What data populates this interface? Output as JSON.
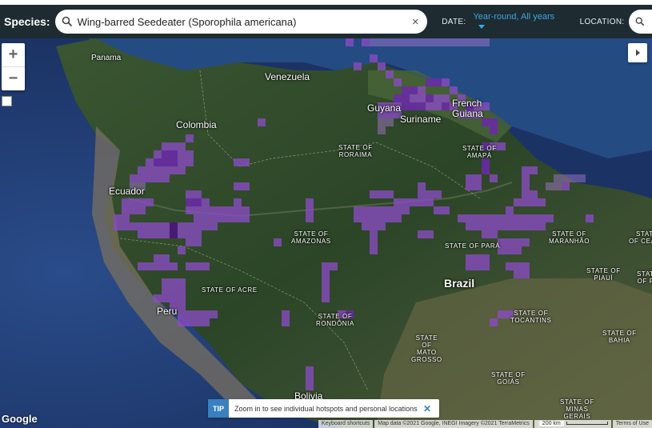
{
  "header": {
    "species_label": "Species:",
    "search_value": "Wing-barred Seedeater (Sporophila americana)",
    "clear_glyph": "×",
    "date_label": "DATE:",
    "date_value": "Year-round, All years",
    "location_label": "LOCATION:"
  },
  "map_controls": {
    "zoom_in": "+",
    "zoom_out": "−"
  },
  "labels": {
    "panama": "Panama",
    "venezuela": "Venezuela",
    "colombia": "Colombia",
    "guyana": "Guyana",
    "suriname": "Suriname",
    "french_guiana": "French\nGuiana",
    "ecuador": "Ecuador",
    "peru": "Peru",
    "brazil": "Brazil",
    "bolivia": "Bolivia",
    "roraima": "STATE OF\nRORAIMA",
    "amapa": "STATE OF\nAMAPÁ",
    "amazonas": "STATE OF\nAMAZONAS",
    "para": "STATE OF PARÁ",
    "maranhao": "STATE OF\nMARANHÃO",
    "ceara": "STATE\nOF CEARÁ",
    "piaui": "STATE OF\nPIAUÍ",
    "paraiba": "STATE\nOF PA",
    "acre": "STATE OF ACRE",
    "rondonia": "STATE OF\nRONDÔNIA",
    "tocantins": "STATE OF\nTOCANTINS",
    "bahia": "STATE OF\nBAHIA",
    "mato_grosso": "STATE\nOF\nMATO\nGROSSO",
    "goias": "STATE OF\nGOIÁS",
    "minas_gerais": "STATE OF\nMINAS\nGERAIS",
    "colombia_top": "Colombia"
  },
  "tip": {
    "badge": "TIP",
    "text": "Zoom in to see individual hotspots and personal locations",
    "close": "✕"
  },
  "attribution": {
    "logo": "Google",
    "shortcuts": "Keyboard shortcuts",
    "map_data": "Map data ©2021 Google, INEGI Imagery ©2021 TerraMetrics",
    "scale": "200 km",
    "terms": "Terms of Use"
  },
  "colors": {
    "header_bg": "#1e2b30",
    "date_accent": "#3aa7e8",
    "ocean": "#1f3b6e",
    "land": "#2f4a2c",
    "range_light": "#b07ad9",
    "range_mid": "#8a4cc4",
    "range_dark": "#4a1877",
    "tip_badge": "#3a7fc0"
  },
  "icons": {
    "search": "search-icon",
    "clear": "close-icon",
    "caret": "chevron-down-icon",
    "panel": "chevron-right-icon",
    "zoom_box": "zoom-area-icon"
  },
  "range_cells": [
    [
      432,
      0,
      2
    ],
    [
      452,
      0,
      2
    ],
    [
      462,
      0,
      1
    ],
    [
      472,
      0,
      1
    ],
    [
      482,
      0,
      1
    ],
    [
      492,
      0,
      1
    ],
    [
      502,
      0,
      1
    ],
    [
      512,
      0,
      1
    ],
    [
      522,
      0,
      1
    ],
    [
      532,
      0,
      1
    ],
    [
      542,
      0,
      1
    ],
    [
      552,
      0,
      1
    ],
    [
      562,
      0,
      1
    ],
    [
      572,
      0,
      1
    ],
    [
      582,
      0,
      1
    ],
    [
      592,
      0,
      1
    ],
    [
      602,
      0,
      1
    ],
    [
      442,
      30,
      2
    ],
    [
      462,
      20,
      2
    ],
    [
      472,
      30,
      2
    ],
    [
      482,
      40,
      2
    ],
    [
      492,
      50,
      2
    ],
    [
      502,
      60,
      3
    ],
    [
      512,
      60,
      3
    ],
    [
      522,
      60,
      2
    ],
    [
      532,
      50,
      3
    ],
    [
      542,
      50,
      3
    ],
    [
      552,
      50,
      2
    ],
    [
      562,
      60,
      2
    ],
    [
      572,
      70,
      2
    ],
    [
      582,
      80,
      3
    ],
    [
      592,
      90,
      2
    ],
    [
      602,
      100,
      3
    ],
    [
      612,
      100,
      3
    ],
    [
      612,
      110,
      3
    ],
    [
      622,
      130,
      2
    ],
    [
      612,
      130,
      2
    ],
    [
      492,
      70,
      3
    ],
    [
      502,
      70,
      3
    ],
    [
      512,
      70,
      2
    ],
    [
      522,
      70,
      2
    ],
    [
      532,
      70,
      3
    ],
    [
      542,
      70,
      2
    ],
    [
      552,
      70,
      2
    ],
    [
      562,
      80,
      2
    ],
    [
      572,
      90,
      2
    ],
    [
      582,
      90,
      2
    ],
    [
      592,
      80,
      2
    ],
    [
      602,
      80,
      2
    ],
    [
      492,
      80,
      2
    ],
    [
      502,
      80,
      3
    ],
    [
      512,
      80,
      3
    ],
    [
      522,
      80,
      3
    ],
    [
      532,
      80,
      2
    ],
    [
      542,
      80,
      2
    ],
    [
      552,
      80,
      3
    ],
    [
      472,
      80,
      2
    ],
    [
      482,
      80,
      2
    ],
    [
      472,
      90,
      2
    ],
    [
      482,
      90,
      2
    ],
    [
      492,
      90,
      2
    ],
    [
      472,
      100,
      1
    ],
    [
      482,
      100,
      1
    ],
    [
      472,
      110,
      1
    ],
    [
      602,
      130,
      3
    ],
    [
      602,
      150,
      3
    ],
    [
      602,
      160,
      3
    ],
    [
      592,
      170,
      2
    ],
    [
      582,
      170,
      2
    ],
    [
      582,
      180,
      2
    ],
    [
      592,
      180,
      2
    ],
    [
      612,
      170,
      2
    ],
    [
      322,
      100,
      2
    ],
    [
      202,
      130,
      2
    ],
    [
      212,
      130,
      2
    ],
    [
      222,
      130,
      2
    ],
    [
      232,
      120,
      2
    ],
    [
      192,
      140,
      2
    ],
    [
      202,
      140,
      3
    ],
    [
      212,
      140,
      3
    ],
    [
      222,
      140,
      2
    ],
    [
      232,
      140,
      2
    ],
    [
      182,
      150,
      2
    ],
    [
      192,
      150,
      3
    ],
    [
      202,
      150,
      3
    ],
    [
      212,
      150,
      3
    ],
    [
      222,
      150,
      2
    ],
    [
      232,
      150,
      2
    ],
    [
      172,
      160,
      2
    ],
    [
      182,
      160,
      2
    ],
    [
      192,
      160,
      2
    ],
    [
      202,
      160,
      2
    ],
    [
      212,
      160,
      2
    ],
    [
      222,
      160,
      2
    ],
    [
      162,
      170,
      2
    ],
    [
      172,
      170,
      2
    ],
    [
      182,
      170,
      2
    ],
    [
      192,
      170,
      2
    ],
    [
      202,
      170,
      2
    ],
    [
      162,
      180,
      1
    ],
    [
      172,
      180,
      1
    ],
    [
      292,
      150,
      2
    ],
    [
      302,
      150,
      2
    ],
    [
      292,
      180,
      2
    ],
    [
      302,
      180,
      2
    ],
    [
      152,
      200,
      2
    ],
    [
      162,
      200,
      2
    ],
    [
      172,
      200,
      2
    ],
    [
      182,
      200,
      2
    ],
    [
      152,
      210,
      2
    ],
    [
      162,
      210,
      2
    ],
    [
      172,
      210,
      2
    ],
    [
      142,
      220,
      2
    ],
    [
      152,
      220,
      2
    ],
    [
      142,
      230,
      2
    ],
    [
      152,
      230,
      2
    ],
    [
      162,
      230,
      2
    ],
    [
      172,
      230,
      2
    ],
    [
      182,
      230,
      2
    ],
    [
      192,
      230,
      2
    ],
    [
      202,
      230,
      2
    ],
    [
      212,
      230,
      4
    ],
    [
      222,
      230,
      2
    ],
    [
      232,
      230,
      2
    ],
    [
      242,
      230,
      2
    ],
    [
      172,
      240,
      2
    ],
    [
      182,
      240,
      2
    ],
    [
      192,
      240,
      2
    ],
    [
      202,
      240,
      2
    ],
    [
      212,
      240,
      4
    ],
    [
      222,
      240,
      2
    ],
    [
      232,
      240,
      2
    ],
    [
      242,
      240,
      2
    ],
    [
      232,
      190,
      2
    ],
    [
      242,
      190,
      2
    ],
    [
      232,
      200,
      3
    ],
    [
      242,
      200,
      3
    ],
    [
      252,
      200,
      2
    ],
    [
      232,
      210,
      2
    ],
    [
      242,
      210,
      2
    ],
    [
      252,
      210,
      2
    ],
    [
      262,
      210,
      2
    ],
    [
      272,
      210,
      2
    ],
    [
      282,
      210,
      2
    ],
    [
      292,
      210,
      2
    ],
    [
      302,
      210,
      2
    ],
    [
      242,
      220,
      2
    ],
    [
      252,
      220,
      2
    ],
    [
      262,
      220,
      2
    ],
    [
      272,
      220,
      2
    ],
    [
      282,
      220,
      2
    ],
    [
      292,
      220,
      2
    ],
    [
      302,
      220,
      2
    ],
    [
      252,
      230,
      2
    ],
    [
      262,
      230,
      2
    ],
    [
      292,
      200,
      2
    ],
    [
      232,
      250,
      2
    ],
    [
      242,
      250,
      2
    ],
    [
      222,
      260,
      2
    ],
    [
      192,
      270,
      2
    ],
    [
      202,
      270,
      2
    ],
    [
      172,
      280,
      2
    ],
    [
      182,
      280,
      2
    ],
    [
      192,
      280,
      2
    ],
    [
      202,
      280,
      2
    ],
    [
      212,
      280,
      2
    ],
    [
      232,
      280,
      2
    ],
    [
      242,
      280,
      2
    ],
    [
      252,
      280,
      2
    ],
    [
      202,
      300,
      2
    ],
    [
      212,
      300,
      2
    ],
    [
      222,
      300,
      2
    ],
    [
      202,
      310,
      2
    ],
    [
      212,
      310,
      2
    ],
    [
      222,
      310,
      2
    ],
    [
      192,
      320,
      2
    ],
    [
      202,
      320,
      2
    ],
    [
      212,
      320,
      2
    ],
    [
      222,
      320,
      2
    ],
    [
      212,
      330,
      2
    ],
    [
      222,
      330,
      2
    ],
    [
      222,
      340,
      2
    ],
    [
      232,
      340,
      2
    ],
    [
      242,
      340,
      2
    ],
    [
      252,
      340,
      2
    ],
    [
      262,
      340,
      2
    ],
    [
      222,
      350,
      2
    ],
    [
      232,
      350,
      2
    ],
    [
      242,
      350,
      2
    ],
    [
      252,
      350,
      2
    ],
    [
      342,
      250,
      2
    ],
    [
      382,
      200,
      2
    ],
    [
      382,
      210,
      2
    ],
    [
      382,
      220,
      2
    ],
    [
      402,
      280,
      2
    ],
    [
      412,
      280,
      2
    ],
    [
      402,
      290,
      2
    ],
    [
      402,
      300,
      2
    ],
    [
      402,
      310,
      2
    ],
    [
      402,
      320,
      2
    ],
    [
      352,
      340,
      2
    ],
    [
      352,
      350,
      2
    ],
    [
      422,
      340,
      2
    ],
    [
      432,
      340,
      3
    ],
    [
      382,
      410,
      2
    ],
    [
      382,
      420,
      2
    ],
    [
      382,
      430,
      2
    ],
    [
      462,
      190,
      2
    ],
    [
      472,
      190,
      2
    ],
    [
      482,
      190,
      2
    ],
    [
      492,
      200,
      2
    ],
    [
      502,
      200,
      2
    ],
    [
      512,
      200,
      2
    ],
    [
      522,
      200,
      2
    ],
    [
      532,
      200,
      2
    ],
    [
      542,
      190,
      2
    ],
    [
      522,
      180,
      2
    ],
    [
      522,
      190,
      2
    ],
    [
      532,
      190,
      2
    ],
    [
      442,
      210,
      2
    ],
    [
      452,
      210,
      2
    ],
    [
      462,
      210,
      2
    ],
    [
      472,
      210,
      2
    ],
    [
      482,
      210,
      2
    ],
    [
      492,
      210,
      2
    ],
    [
      502,
      210,
      2
    ],
    [
      442,
      220,
      2
    ],
    [
      452,
      220,
      2
    ],
    [
      462,
      220,
      2
    ],
    [
      472,
      220,
      2
    ],
    [
      482,
      220,
      2
    ],
    [
      492,
      220,
      2
    ],
    [
      452,
      230,
      2
    ],
    [
      462,
      230,
      2
    ],
    [
      472,
      230,
      2
    ],
    [
      462,
      240,
      2
    ],
    [
      462,
      250,
      2
    ],
    [
      462,
      260,
      2
    ],
    [
      542,
      210,
      2
    ],
    [
      552,
      210,
      2
    ],
    [
      522,
      240,
      2
    ],
    [
      532,
      240,
      2
    ],
    [
      572,
      220,
      2
    ],
    [
      582,
      220,
      2
    ],
    [
      592,
      220,
      2
    ],
    [
      602,
      220,
      2
    ],
    [
      612,
      220,
      2
    ],
    [
      622,
      220,
      2
    ],
    [
      632,
      220,
      2
    ],
    [
      642,
      220,
      2
    ],
    [
      652,
      220,
      2
    ],
    [
      662,
      220,
      2
    ],
    [
      672,
      220,
      2
    ],
    [
      682,
      220,
      2
    ],
    [
      582,
      230,
      2
    ],
    [
      592,
      230,
      2
    ],
    [
      602,
      230,
      2
    ],
    [
      612,
      230,
      2
    ],
    [
      622,
      230,
      2
    ],
    [
      632,
      230,
      2
    ],
    [
      642,
      230,
      2
    ],
    [
      652,
      230,
      2
    ],
    [
      662,
      230,
      2
    ],
    [
      672,
      230,
      2
    ],
    [
      602,
      240,
      2
    ],
    [
      612,
      240,
      2
    ],
    [
      622,
      250,
      2
    ],
    [
      632,
      250,
      2
    ],
    [
      642,
      250,
      2
    ],
    [
      652,
      250,
      2
    ],
    [
      622,
      260,
      2
    ],
    [
      632,
      260,
      2
    ],
    [
      642,
      260,
      2
    ],
    [
      582,
      270,
      2
    ],
    [
      592,
      270,
      2
    ],
    [
      602,
      270,
      2
    ],
    [
      582,
      280,
      2
    ],
    [
      592,
      280,
      2
    ],
    [
      602,
      280,
      2
    ],
    [
      632,
      280,
      2
    ],
    [
      642,
      280,
      2
    ],
    [
      652,
      280,
      2
    ],
    [
      642,
      290,
      2
    ],
    [
      652,
      290,
      2
    ],
    [
      632,
      210,
      2
    ],
    [
      642,
      200,
      2
    ],
    [
      652,
      200,
      2
    ],
    [
      662,
      200,
      2
    ],
    [
      672,
      200,
      2
    ],
    [
      652,
      180,
      2
    ],
    [
      652,
      190,
      2
    ],
    [
      662,
      190,
      2
    ],
    [
      652,
      160,
      2
    ],
    [
      652,
      170,
      2
    ],
    [
      662,
      160,
      2
    ],
    [
      682,
      180,
      1
    ],
    [
      692,
      180,
      1
    ],
    [
      702,
      180,
      2
    ],
    [
      692,
      170,
      1
    ],
    [
      702,
      170,
      1
    ],
    [
      712,
      170,
      1
    ],
    [
      722,
      170,
      1
    ],
    [
      732,
      220,
      2
    ],
    [
      622,
      340,
      2
    ],
    [
      632,
      340,
      2
    ],
    [
      612,
      350,
      2
    ]
  ]
}
